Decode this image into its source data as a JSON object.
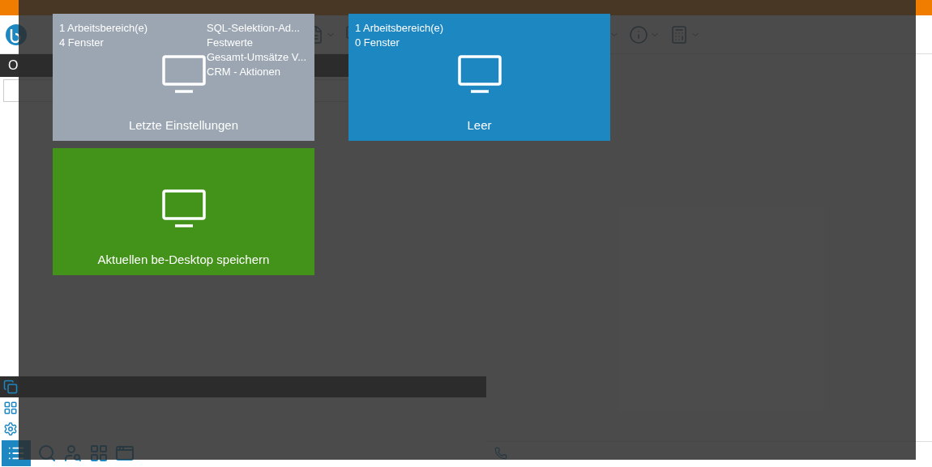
{
  "open_windows_panel": {
    "title": "O"
  },
  "navigation": [
    {
      "kind": "windows",
      "selected": true
    },
    {
      "kind": "grid",
      "selected": false
    },
    {
      "kind": "settings",
      "selected": false
    }
  ],
  "desktop_tiles": [
    {
      "kind": "desktop",
      "title": "Letzte Einstellungen",
      "color": "#9ba6b2",
      "info": [
        "1 Arbeitsbereich(e)",
        "4 Fenster"
      ],
      "windows": [
        "SQL-Selektion-Ad...",
        "Festwerte",
        "Gesamt-Umsätze V...",
        "CRM - Aktionen"
      ]
    },
    {
      "kind": "desktop",
      "title": "Leer",
      "color": "#1d87c2",
      "info": [
        "1 Arbeitsbereich(e)",
        "0 Fenster"
      ]
    },
    {
      "kind": "save",
      "title": "Aktuellen be-Desktop speichern",
      "color": "#43921a"
    }
  ]
}
